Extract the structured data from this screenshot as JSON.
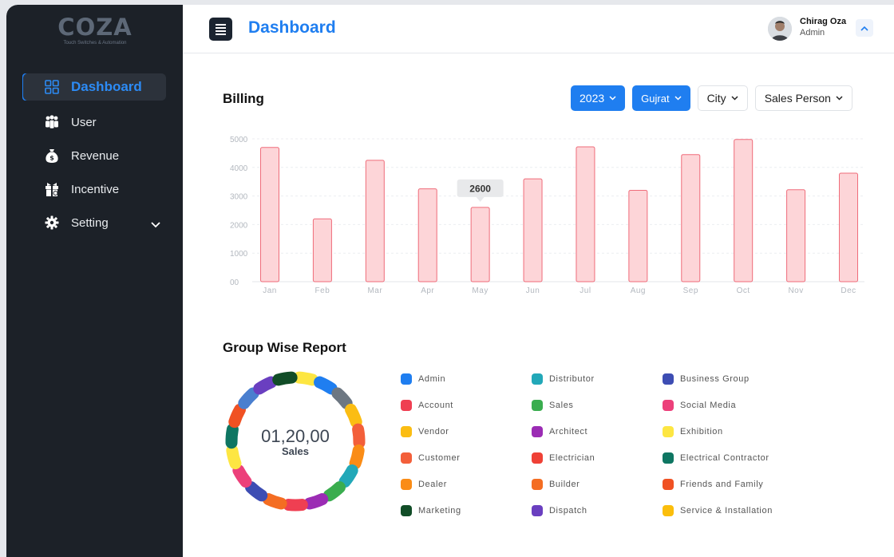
{
  "brand": {
    "name": "COZA",
    "tagline": "Touch Switches & Automation"
  },
  "sidebar": {
    "items": [
      {
        "label": "Dashboard",
        "icon": "grid-icon",
        "active": true
      },
      {
        "label": "User",
        "icon": "users-icon"
      },
      {
        "label": "Revenue",
        "icon": "money-bag-icon"
      },
      {
        "label": "Incentive",
        "icon": "gift-icon"
      },
      {
        "label": "Setting",
        "icon": "gear-icon",
        "expandable": true
      }
    ]
  },
  "header": {
    "title": "Dashboard",
    "user_name": "Chirag Oza",
    "user_role": "Admin"
  },
  "billing": {
    "title": "Billing",
    "filters": [
      {
        "label": "2023",
        "style": "primary"
      },
      {
        "label": "Gujrat",
        "style": "primary"
      },
      {
        "label": "City",
        "style": "outline"
      },
      {
        "label": "Sales Person",
        "style": "outline"
      }
    ]
  },
  "chart_data": {
    "type": "bar",
    "categories": [
      "Jan",
      "Feb",
      "Mar",
      "Apr",
      "May",
      "Jun",
      "Jul",
      "Aug",
      "Sep",
      "Oct",
      "Nov",
      "Dec"
    ],
    "values": [
      4700,
      2200,
      4250,
      3250,
      2600,
      3600,
      4720,
      3200,
      4450,
      4980,
      3220,
      3800
    ],
    "y_ticks": [
      "00",
      "1000",
      "2000",
      "3000",
      "4000",
      "5000"
    ],
    "ylim": [
      0,
      5000
    ],
    "tooltip": {
      "category": "May",
      "label": "2600"
    },
    "grid": true,
    "bar_fill": "#fdd5d8",
    "bar_stroke": "#ef6c7a"
  },
  "group_report": {
    "title": "Group Wise Report",
    "total_value": "01,20,00",
    "total_label": "Sales",
    "legend": [
      {
        "label": "Admin",
        "color": "#1f7ef0"
      },
      {
        "label": "Account",
        "color": "#ef3f52"
      },
      {
        "label": "Vendor",
        "color": "#fbbd13"
      },
      {
        "label": "Customer",
        "color": "#f35f3a"
      },
      {
        "label": "Dealer",
        "color": "#fa8c16"
      },
      {
        "label": "Marketing",
        "color": "#114d27"
      },
      {
        "label": "Distributor",
        "color": "#22a8b8"
      },
      {
        "label": "Sales",
        "color": "#3aad4f"
      },
      {
        "label": "Architect",
        "color": "#9b2cb4"
      },
      {
        "label": "Electrician",
        "color": "#ef4136"
      },
      {
        "label": "Builder",
        "color": "#f46d22"
      },
      {
        "label": "Dispatch",
        "color": "#6a3fc0"
      },
      {
        "label": "Business Group",
        "color": "#3d4db3"
      },
      {
        "label": "Social Media",
        "color": "#ec407a"
      },
      {
        "label": "Exhibition",
        "color": "#fde642"
      },
      {
        "label": "Electrical Contractor",
        "color": "#0e7662"
      },
      {
        "label": "Friends and Family",
        "color": "#f05123"
      },
      {
        "label": "Service & Installation",
        "color": "#fbbe0c"
      }
    ],
    "donut_colors": [
      "#fde642",
      "#1f7ef0",
      "#6d7782",
      "#fbbd13",
      "#f35f3a",
      "#fa8c16",
      "#22a8b8",
      "#3aad4f",
      "#9b2cb4",
      "#ef3f52",
      "#f46d22",
      "#3d4db3",
      "#ec407a",
      "#fde642",
      "#0e7662",
      "#f05123",
      "#4a7fcf",
      "#6a3fc0",
      "#114d27"
    ]
  }
}
